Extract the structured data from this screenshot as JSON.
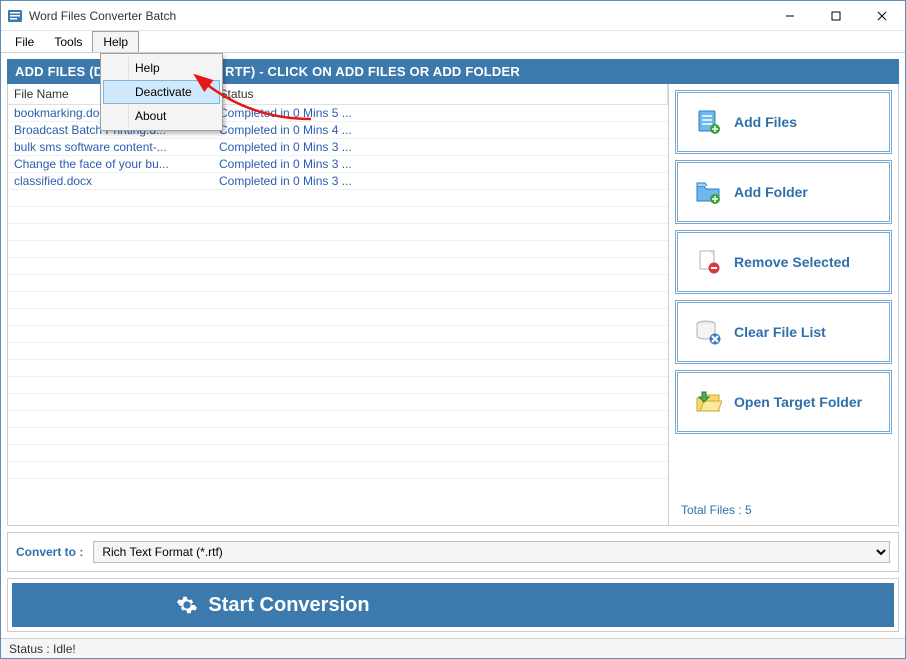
{
  "window": {
    "title": "Word Files Converter Batch"
  },
  "menu": {
    "items": [
      "File",
      "Tools",
      "Help"
    ],
    "open_index": 2,
    "dropdown": [
      "Help",
      "Deactivate",
      "About"
    ],
    "hover_index": 1
  },
  "banner": "ADD FILES (DOC, DOCX, DOCM, RTF) - CLICK ON ADD FILES OR ADD FOLDER",
  "table": {
    "headers": [
      "File Name",
      "Status"
    ],
    "rows": [
      {
        "name": "bookmarking.docx",
        "status": "Completed in 0 Mins 5 ..."
      },
      {
        "name": "Broadcast Batch Printing.d...",
        "status": "Completed in 0 Mins 4 ..."
      },
      {
        "name": "bulk sms software content-...",
        "status": "Completed in 0 Mins 3 ..."
      },
      {
        "name": "Change the face of your bu...",
        "status": "Completed in 0 Mins 3 ..."
      },
      {
        "name": "classified.docx",
        "status": "Completed in 0 Mins 3 ..."
      }
    ]
  },
  "sidebar": {
    "buttons": [
      "Add Files",
      "Add Folder",
      "Remove Selected",
      "Clear File List",
      "Open Target Folder"
    ],
    "total_label": "Total Files : 5"
  },
  "convert": {
    "label": "Convert to :",
    "selected": "Rich Text Format (*.rtf)"
  },
  "start_label": "Start Conversion",
  "status": "Status  :  Idle!"
}
